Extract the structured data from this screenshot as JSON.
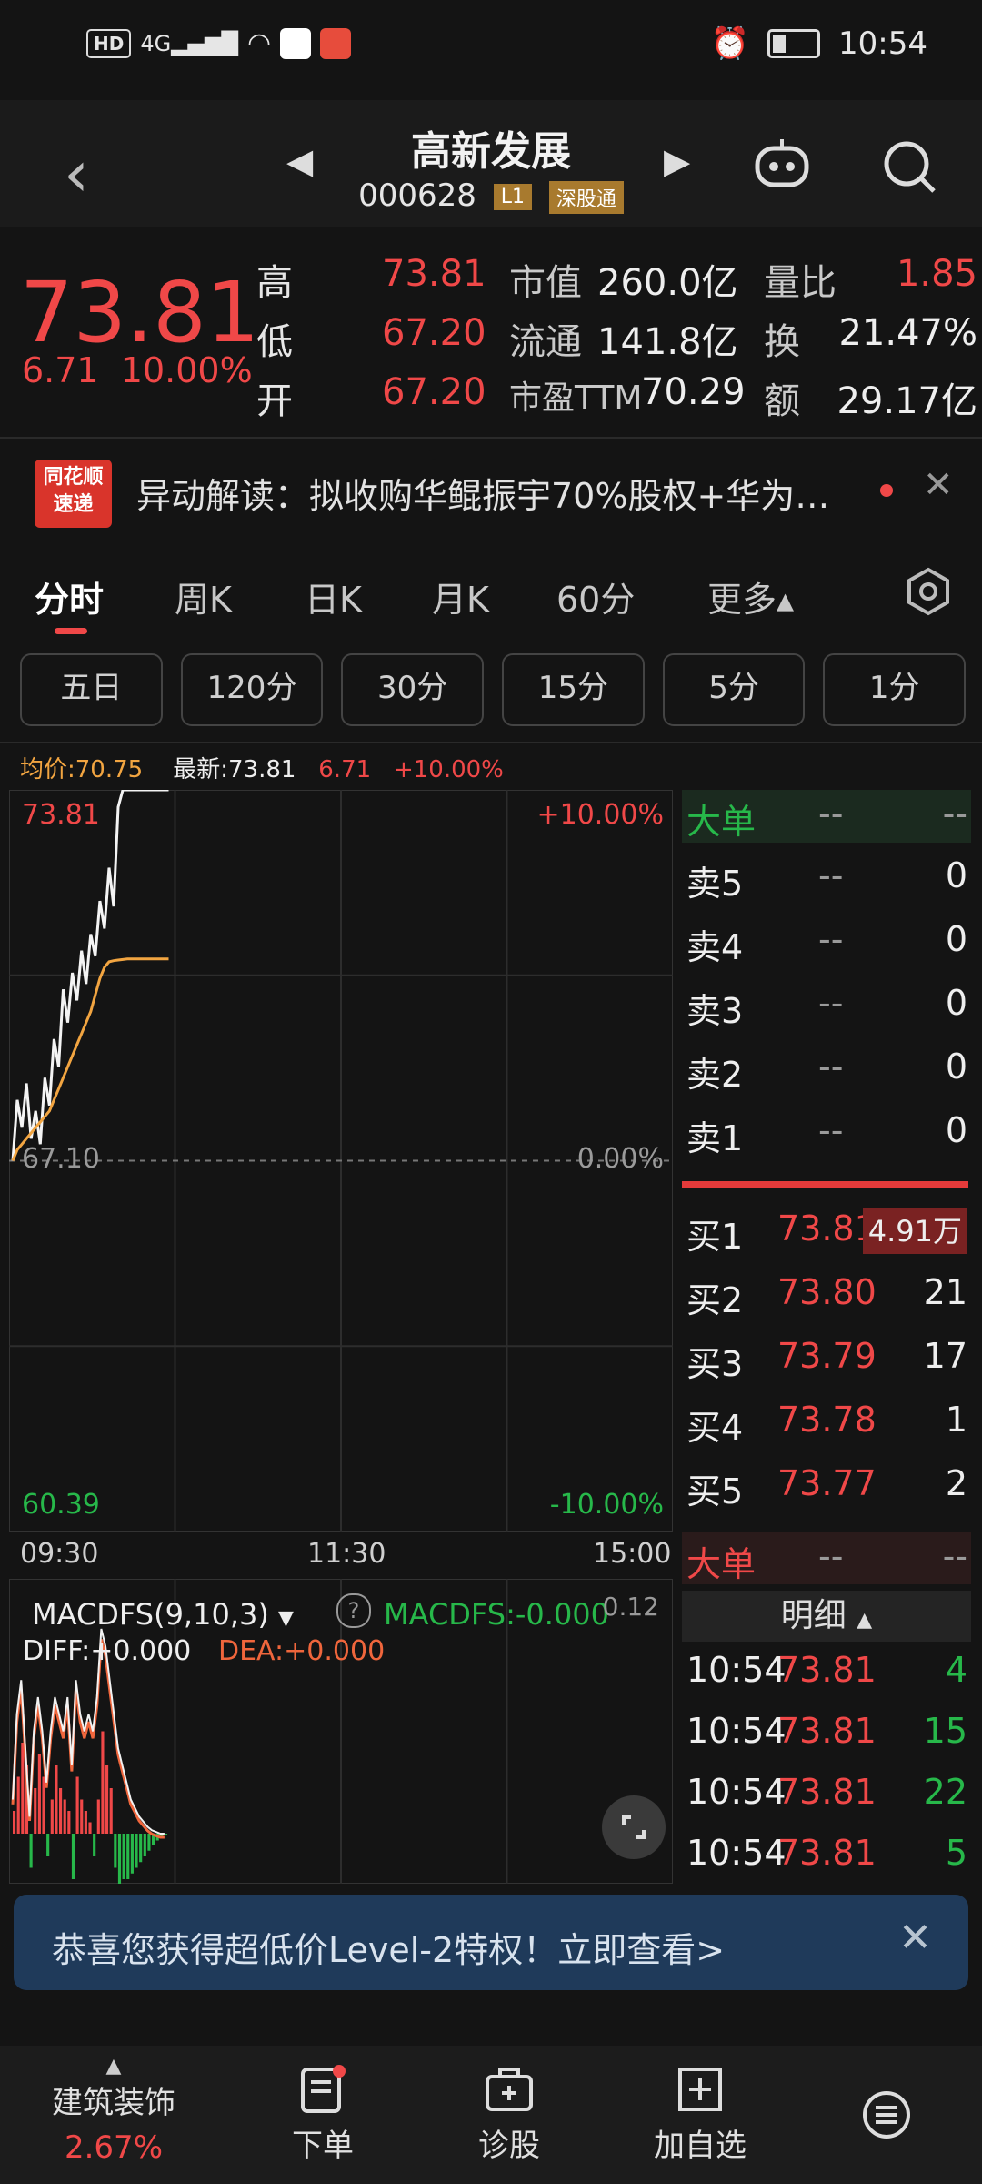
{
  "status_bar": {
    "network": "HD",
    "signal": "4G",
    "time": "10:54"
  },
  "header": {
    "title": "高新发展",
    "code": "000628",
    "level_tag": "L1",
    "market_tag": "深股通"
  },
  "quote": {
    "price": "73.81",
    "change": "6.71",
    "change_pct": "10.00%",
    "high_label": "高",
    "high": "73.81",
    "low_label": "低",
    "low": "67.20",
    "open_label": "开",
    "open": "67.20",
    "mcap_label": "市值",
    "mcap": "260.0亿",
    "float_label": "流通",
    "float": "141.8亿",
    "pe_label": "市盈TTM",
    "pe": "70.29",
    "vol_ratio_label": "量比",
    "vol_ratio": "1.85",
    "turnover_label": "换",
    "turnover": "21.47%",
    "amount_label": "额",
    "amount": "29.17亿"
  },
  "news": {
    "logo_top": "同花顺",
    "logo_bottom": "速递",
    "text": "异动解读：拟收购华鲲振宇70%股权+华为…"
  },
  "tabs": [
    {
      "label": "分时",
      "active": true
    },
    {
      "label": "周K"
    },
    {
      "label": "日K"
    },
    {
      "label": "月K"
    },
    {
      "label": "60分"
    },
    {
      "label": "更多▴"
    }
  ],
  "periods": [
    "五日",
    "120分",
    "30分",
    "15分",
    "5分",
    "1分"
  ],
  "chart_info": {
    "avg_label": "均价:70.75",
    "latest_label": "最新:73.81",
    "chg": "6.71",
    "pct": "+10.00%"
  },
  "chart_data": {
    "type": "line",
    "y_top_label": "73.81",
    "y_mid_label": "67.10",
    "y_bottom_label": "60.39",
    "pct_top_label": "+10.00%",
    "pct_mid_label": "0.00%",
    "pct_bottom_label": "-10.00%",
    "ylim": [
      60.39,
      73.81
    ],
    "x_ticks": [
      "09:30",
      "11:30",
      "15:00"
    ],
    "series": [
      {
        "values": [
          67.1,
          68.2,
          67.7,
          68.5,
          67.5,
          68.0,
          67.4,
          68.6,
          68.1,
          69.3,
          68.8,
          70.2,
          69.6,
          70.5,
          70.0,
          70.9,
          70.3,
          71.2,
          70.8,
          71.8,
          71.3,
          72.4,
          71.7,
          73.5,
          73.81,
          73.81,
          73.81,
          73.81,
          73.81,
          73.81,
          73.81,
          73.81,
          73.81,
          73.81,
          73.81
        ]
      },
      {
        "values": [
          67.1,
          67.3,
          67.4,
          67.5,
          67.6,
          67.7,
          67.8,
          67.9,
          68.0,
          68.2,
          68.4,
          68.6,
          68.8,
          69.0,
          69.2,
          69.4,
          69.6,
          69.8,
          70.1,
          70.4,
          70.6,
          70.7,
          70.72,
          70.73,
          70.74,
          70.75,
          70.75,
          70.75,
          70.75,
          70.75,
          70.75,
          70.75,
          70.75,
          70.75,
          70.75
        ]
      }
    ]
  },
  "macd": {
    "title": "MACDFS(9,10,3)",
    "value_label": "MACDFS:-0.000",
    "scale": "0.12",
    "diff": "DIFF:+0.000",
    "dea": "DEA:+0.000",
    "hist": [
      0.02,
      0.05,
      0.08,
      0.06,
      -0.03,
      0.04,
      0.07,
      0.05,
      -0.02,
      0.03,
      0.06,
      0.04,
      0.03,
      0.02,
      -0.04,
      0.05,
      0.03,
      0.02,
      0.01,
      -0.02,
      0.03,
      0.09,
      0.06,
      0.04,
      -0.03,
      -0.05,
      -0.04,
      -0.04,
      -0.035,
      -0.03,
      -0.025,
      -0.02,
      -0.015,
      -0.01,
      -0.006,
      -0.003,
      -0.001
    ],
    "line": [
      0.02,
      0.07,
      0.09,
      0.05,
      0.01,
      0.06,
      0.08,
      0.06,
      0.03,
      0.06,
      0.08,
      0.07,
      0.06,
      0.08,
      0.04,
      0.09,
      0.07,
      0.06,
      0.07,
      0.06,
      0.08,
      0.12,
      0.11,
      0.09,
      0.07,
      0.05,
      0.04,
      0.03,
      0.02,
      0.015,
      0.01,
      0.007,
      0.004,
      0.002,
      0.001,
      0.0,
      0.0
    ]
  },
  "order_book": {
    "big_order_label": "大单",
    "dash": "--",
    "asks": [
      {
        "label": "卖5",
        "price": "--",
        "vol": "0"
      },
      {
        "label": "卖4",
        "price": "--",
        "vol": "0"
      },
      {
        "label": "卖3",
        "price": "--",
        "vol": "0"
      },
      {
        "label": "卖2",
        "price": "--",
        "vol": "0"
      },
      {
        "label": "卖1",
        "price": "--",
        "vol": "0"
      }
    ],
    "bids": [
      {
        "label": "买1",
        "price": "73.81",
        "vol": "4.91万"
      },
      {
        "label": "买2",
        "price": "73.80",
        "vol": "21"
      },
      {
        "label": "买3",
        "price": "73.79",
        "vol": "17"
      },
      {
        "label": "买4",
        "price": "73.78",
        "vol": "1"
      },
      {
        "label": "买5",
        "price": "73.77",
        "vol": "2"
      }
    ],
    "detail_label": "明细",
    "ticks": [
      {
        "time": "10:54",
        "price": "73.81",
        "vol": "4"
      },
      {
        "time": "10:54",
        "price": "73.81",
        "vol": "15"
      },
      {
        "time": "10:54",
        "price": "73.81",
        "vol": "22"
      },
      {
        "time": "10:54",
        "price": "73.81",
        "vol": "5"
      }
    ]
  },
  "banner": {
    "text": "恭喜您获得超低价Level-2特权！立即查看>"
  },
  "bottom_bar": {
    "sector_name": "建筑装饰",
    "sector_pct": "2.67%",
    "order": "下单",
    "diagnose": "诊股",
    "add_watch": "加自选"
  },
  "colors": {
    "up": "#f04848",
    "down": "#27b84a",
    "avg_line": "#f2a541",
    "price_line": "#f4f4f4"
  }
}
